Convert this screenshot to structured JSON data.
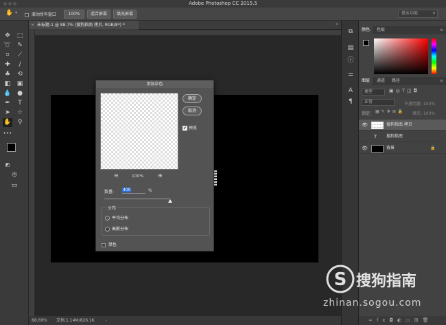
{
  "app": {
    "title": "Adobe Photoshop CC 2015.5"
  },
  "optbar": {
    "scroll_all_label": "滚动所有窗口",
    "zoom_label": "100%",
    "fit_label": "适合屏幕",
    "fill_label": "填充屏幕",
    "workspace": "基本功能"
  },
  "document": {
    "tab_title": "未标题-1 @ 88.7% (搜狗指南 拷贝, RGB/8*) *"
  },
  "status": {
    "zoom": "88.69%",
    "doc_info": "文档:1.14M/826.1K"
  },
  "colors": {
    "fg": "#000000",
    "bg": "#ffffff",
    "accent": "#2d6fd6"
  },
  "color_panel": {
    "tabs": [
      "颜色",
      "色板"
    ]
  },
  "layers_panel": {
    "tabs": [
      "图层",
      "通道",
      "路径"
    ],
    "kind_label": "类型",
    "blend_mode": "正常",
    "opacity_label": "不透明度: 100%",
    "lock_label": "锁定:",
    "fill_label": "填充: 100%",
    "layers": [
      {
        "name": "搜狗指南 拷贝",
        "kind": "pixel"
      },
      {
        "name": "搜狗指南",
        "kind": "text"
      },
      {
        "name": "背景",
        "kind": "background"
      }
    ]
  },
  "dialog": {
    "title": "添加杂色",
    "ok_label": "确定",
    "cancel_label": "取消",
    "preview_label": "预览",
    "zoom_level": "100%",
    "amount_label": "数量:",
    "amount_value": "400",
    "amount_unit": "%",
    "amount_slider_fraction": 1.0,
    "distribution_label": "分布",
    "uniform_label": "平均分布",
    "gaussian_label": "高斯分布",
    "mono_label": "单色"
  },
  "watermark": {
    "brand": "搜狗指南",
    "url": "zhinan.sogou.com"
  }
}
